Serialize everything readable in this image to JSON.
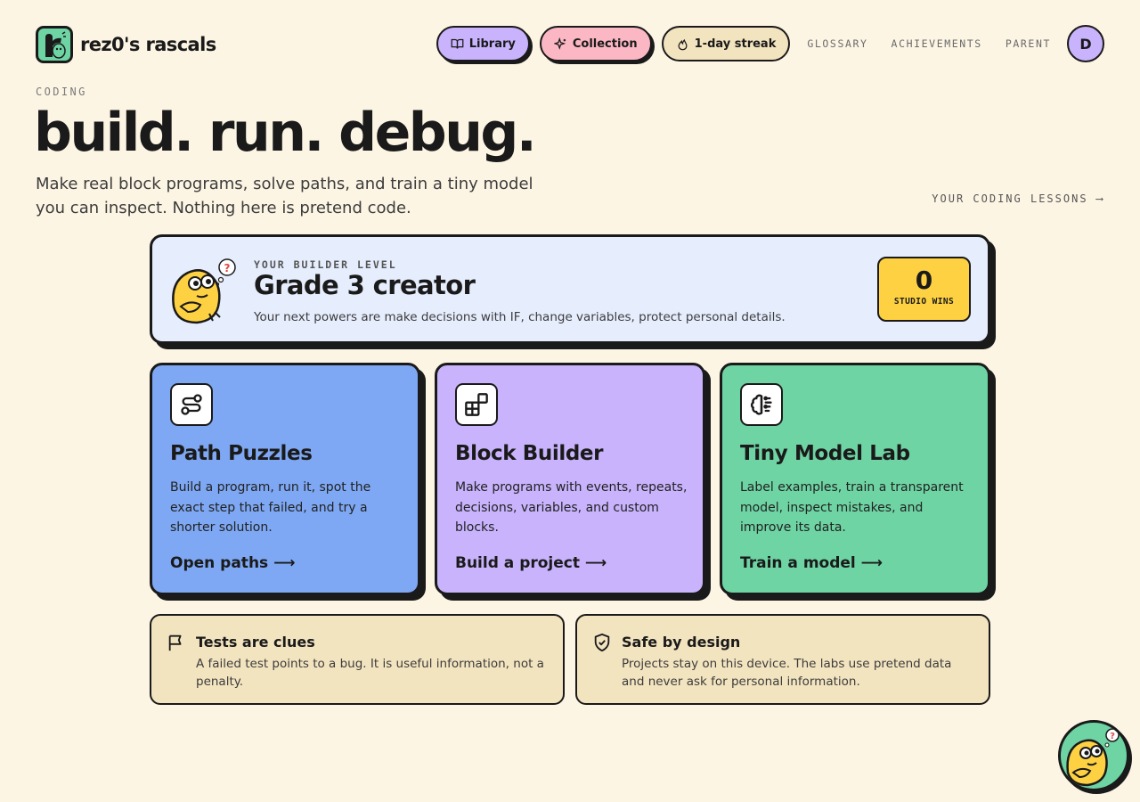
{
  "brand": {
    "name": "rez0's rascals",
    "logo_icon": "rascal-logo-icon"
  },
  "nav": {
    "library": {
      "label": "Library",
      "icon": "book-icon",
      "color": "#c8b3fc"
    },
    "collection": {
      "label": "Collection",
      "icon": "sparkles-icon",
      "color": "#fbb8c4"
    },
    "streak": {
      "label": "1-day streak",
      "icon": "flame-icon",
      "color": "#f3e4c0"
    },
    "links": [
      "GLOSSARY",
      "ACHIEVEMENTS",
      "PARENT"
    ],
    "avatar_initial": "D"
  },
  "hero": {
    "eyebrow": "CODING",
    "title": "build. run. debug.",
    "description": "Make real block programs, solve paths, and train a tiny model you can inspect. Nothing here is pretend code.",
    "lessons_link": "YOUR CODING LESSONS ⟶"
  },
  "level": {
    "eyebrow": "YOUR BUILDER LEVEL",
    "title": "Grade 3 creator",
    "description": "Your next powers are make decisions with IF, change variables, protect personal details.",
    "wins_count": "0",
    "wins_label": "STUDIO WINS",
    "mascot_icon": "thinking-mascot-icon"
  },
  "activities": [
    {
      "title": "Path Puzzles",
      "description": "Build a program, run it, spot the exact step that failed, and try a shorter solution.",
      "cta": "Open paths ⟶",
      "icon": "path-icon",
      "color": "#7ea8f3"
    },
    {
      "title": "Block Builder",
      "description": "Make programs with events, repeats, decisions, variables, and custom blocks.",
      "cta": "Build a project ⟶",
      "icon": "blocks-icon",
      "color": "#c8b3fc"
    },
    {
      "title": "Tiny Model Lab",
      "description": "Label examples, train a transparent model, inspect mistakes, and improve its data.",
      "cta": "Train a model ⟶",
      "icon": "brain-icon",
      "color": "#6ed4a4"
    }
  ],
  "info": [
    {
      "title": "Tests are clues",
      "description": "A failed test points to a bug. It is useful information, not a penalty.",
      "icon": "flag-icon"
    },
    {
      "title": "Safe by design",
      "description": "Projects stay on this device. The labs use pretend data and never ask for personal information.",
      "icon": "shield-check-icon"
    }
  ],
  "colors": {
    "background": "#fdf5e4",
    "ink": "#1a1a1a",
    "level_card": "#e6edfd",
    "wins_badge": "#fdd142",
    "info_card": "#f3e4c0"
  }
}
